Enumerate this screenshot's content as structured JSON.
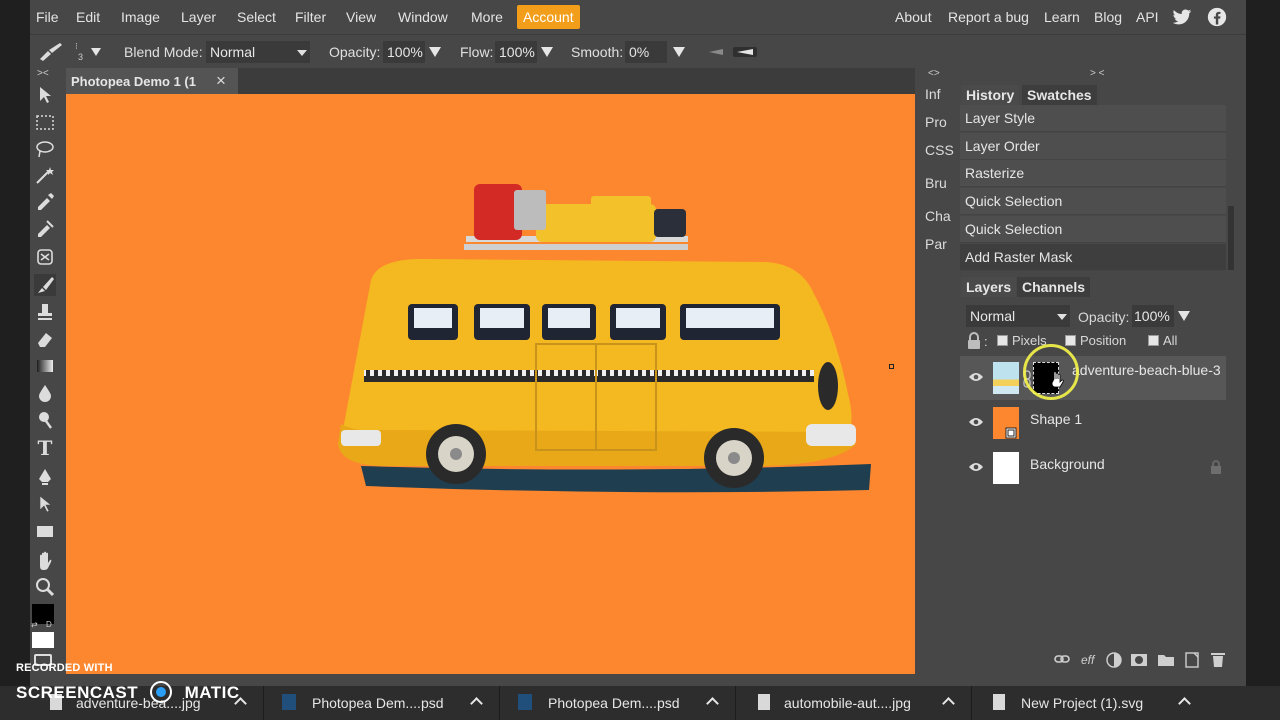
{
  "menu": {
    "items": [
      "File",
      "Edit",
      "Image",
      "Layer",
      "Select",
      "Filter",
      "View",
      "Window",
      "More"
    ],
    "account": "Account",
    "right_items": [
      "About",
      "Report a bug",
      "Learn",
      "Blog",
      "API"
    ],
    "accent_color": "#f29e1a"
  },
  "options": {
    "brush_size": "3",
    "blend_mode_label": "Blend Mode:",
    "blend_mode_value": "Normal",
    "opacity_label": "Opacity:",
    "opacity_value": "100%",
    "flow_label": "Flow:",
    "flow_value": "100%",
    "smooth_label": "Smooth:",
    "smooth_value": "0%"
  },
  "document": {
    "tab_title": "Photopea Demo 1 (1",
    "close_glyph": "×",
    "canvas_color": "#fd872f"
  },
  "side_tabs": [
    "Inf",
    "Pro",
    "CSS",
    "Bru",
    "Cha",
    "Par"
  ],
  "history": {
    "tabs": [
      "History",
      "Swatches"
    ],
    "collapse_glyph": "> <",
    "expand_glyph": "<>",
    "items": [
      "Layer Style",
      "Layer Order",
      "Rasterize",
      "Quick Selection",
      "Quick Selection",
      "Add Raster Mask"
    ]
  },
  "layers": {
    "tabs": [
      "Layers",
      "Channels"
    ],
    "blend_mode": "Normal",
    "opacity_label": "Opacity:",
    "opacity_value": "100%",
    "lock_label": ":",
    "lock_options": [
      "Pixels",
      "Position",
      "All"
    ],
    "items": [
      {
        "name": "adventure-beach-blue-3"
      },
      {
        "name": "Shape 1"
      },
      {
        "name": "Background"
      }
    ],
    "footer_icons": [
      "link-icon",
      "eff",
      "adjustment-icon",
      "mask-icon",
      "folder-icon",
      "new-layer-icon",
      "trash-icon"
    ],
    "footer_eff": "eff"
  },
  "toolbar": {
    "icons": [
      "move-icon",
      "marquee-icon",
      "lasso-icon",
      "magic-wand-icon",
      "eyedropper-icon",
      "healing-icon",
      "stamp-icon",
      "brush-icon",
      "clone-icon",
      "eraser-icon",
      "gradient-icon",
      "blur-icon",
      "dodge-icon",
      "type-icon",
      "pen-icon",
      "path-select-icon",
      "shape-icon",
      "hand-icon",
      "zoom-icon"
    ],
    "type_glyph": "T"
  },
  "downloads": [
    {
      "name": "adventure-bea....jpg",
      "icon": "file-icon"
    },
    {
      "name": "Photopea Dem....psd",
      "icon": "ps-icon"
    },
    {
      "name": "Photopea Dem....psd",
      "icon": "ps-icon"
    },
    {
      "name": "automobile-aut....jpg",
      "icon": "file-icon"
    },
    {
      "name": "New Project (1).svg",
      "icon": "file-icon"
    }
  ],
  "watermark": {
    "top": "RECORDED WITH",
    "brand_left": "SCREENCAST",
    "brand_right": "MATIC"
  }
}
